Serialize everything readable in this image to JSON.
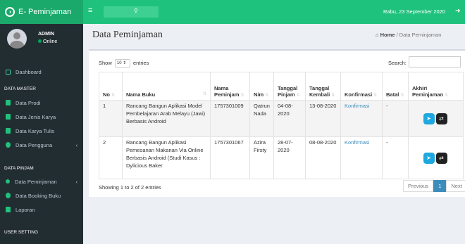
{
  "app": {
    "title": "E- Peminjaman",
    "logo_icon": "logo-icon"
  },
  "topbar": {
    "date": "Rabu, 23 September 2020",
    "search_icon": "search-icon"
  },
  "user": {
    "name": "ADMIN",
    "status": "Online"
  },
  "sidebar": {
    "dashboard": "Dashboard",
    "master_header": "DATA MASTER",
    "master_items": [
      "Data Prodi",
      "Data Jenis Karya",
      "Data Karya Tulis",
      "Data Pengguna"
    ],
    "pinjam_header": "DATA PINJAM",
    "pinjam_items": [
      "Data Peminjaman",
      "Data Booking Buku",
      "Laporan"
    ],
    "setting_header": "USER SETTING"
  },
  "page": {
    "title": "Data Peminjaman",
    "crumb_home": "Home",
    "crumb_sep": "/",
    "crumb_current": "Data Peminjaman"
  },
  "table_controls": {
    "show": "Show",
    "entries_value": "10",
    "entries": "entries",
    "search_label": "Search:"
  },
  "table": {
    "headers": [
      "No",
      "Nama Buku",
      "Nama Peminjam",
      "Nim",
      "Tanggal Pinjam",
      "Tanggal Kembali",
      "Konfirmasi",
      "Batal",
      "Akhiri Peminjaman"
    ],
    "rows": [
      {
        "no": "1",
        "buku": "Rancang Bangun Aplikasi Model Pembelajaran Arab Melayu (Jawi) Berbasis Android",
        "peminjam": "1757301009",
        "nim": "Qatrun Nada",
        "pinjam": "04-08-2020",
        "kembali": "13-08-2020",
        "konfirmasi": "Konfirmasi",
        "batal": "-"
      },
      {
        "no": "2",
        "buku": "Rancang Bangun Aplikasi Pemesanan Makanan Via Online Berbasis Android (Studi Kasus : Dylicious Baker",
        "peminjam": "1757301067",
        "nim": "Azira Firsty",
        "pinjam": "28-07-2020",
        "kembali": "08-08-2020",
        "konfirmasi": "Konfirmasi",
        "batal": "-"
      }
    ]
  },
  "footer": {
    "info": "Showing 1 to 2 of 2 entries",
    "previous": "Previous",
    "page": "1",
    "next": "Next"
  },
  "colors": {
    "topbar": "#1fc27c",
    "sidebar": "#222d32",
    "send_button": "#1fa8e0",
    "swap_button": "#222222"
  }
}
